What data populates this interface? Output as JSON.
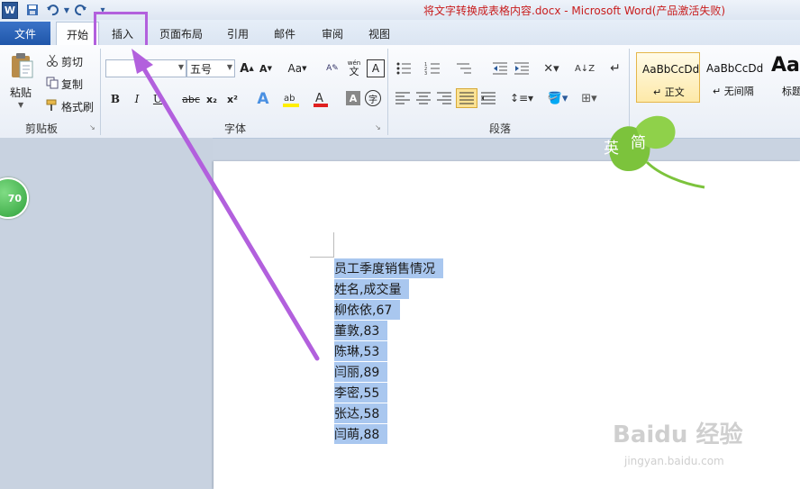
{
  "window": {
    "title": "将文字转换成表格内容.docx - Microsoft Word(产品激活失败)",
    "app_icon": "W"
  },
  "tabs": {
    "file": "文件",
    "items": [
      "开始",
      "插入",
      "页面布局",
      "引用",
      "邮件",
      "审阅",
      "视图"
    ],
    "active": "开始",
    "highlighted": "插入"
  },
  "clipboard": {
    "paste": "粘贴",
    "cut": "剪切",
    "copy": "复制",
    "format_painter": "格式刷",
    "label": "剪贴板"
  },
  "font": {
    "name_value": "",
    "size_value": "五号",
    "label": "字体",
    "grow": "A",
    "shrink": "A",
    "change_case": "Aa",
    "clear_format_glyph": "wén",
    "bold": "B",
    "italic": "I",
    "underline": "U",
    "strike": "abc",
    "subscript": "x₂",
    "superscript": "x²",
    "char_border": "A",
    "enclose": "字",
    "font_color": "#e02020",
    "highlight_color": "#ffee00"
  },
  "paragraph": {
    "label": "段落"
  },
  "styles": {
    "items": [
      {
        "sample": "AaBbCcDd",
        "name": "↵ 正文"
      },
      {
        "sample": "AaBbCcDd",
        "name": "↵ 无间隔"
      },
      {
        "sample": "Aa",
        "name": "标题"
      }
    ]
  },
  "logo": {
    "text1": "英",
    "text2": "简"
  },
  "badge": {
    "text": "70"
  },
  "document": {
    "lines": [
      "员工季度销售情况  ",
      "姓名,成交量  ",
      "柳依依,67  ",
      "董敦,83  ",
      "陈琳,53  ",
      "闫丽,89  ",
      "李密,55  ",
      "张达,58  ",
      "闫萌,88  "
    ],
    "selection_color": "#a9c7ef"
  },
  "watermark": {
    "text": "Baidu 经验",
    "url": "jingyan.baidu.com"
  },
  "annotation": {
    "arrow_color": "#b260dd"
  }
}
